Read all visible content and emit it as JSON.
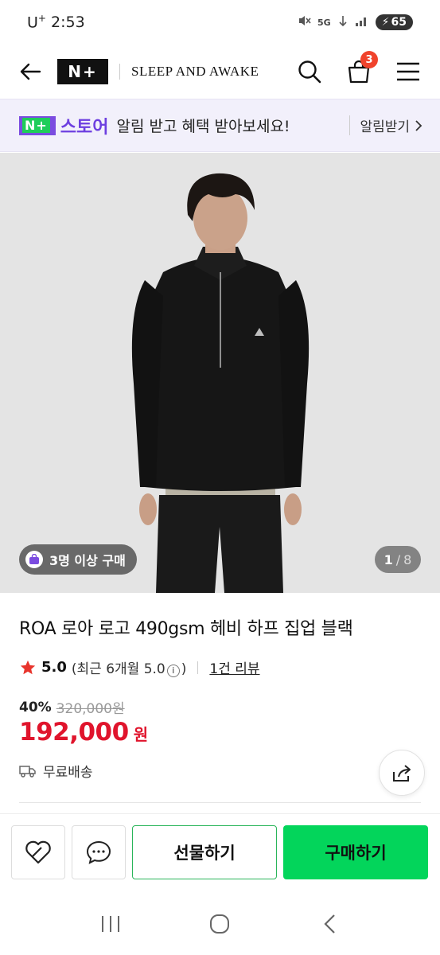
{
  "status_bar": {
    "carrier": "U",
    "carrier_sup": "+",
    "time": "2:53",
    "network": "5G",
    "battery": "65"
  },
  "header": {
    "logo_text": "N+",
    "brand_name": "SLEEP AND AWAKE",
    "cart_count": "3"
  },
  "banner": {
    "logo_mark": "N+",
    "store_label": "스토어",
    "message": "알림 받고 혜택 받아보세요!",
    "cta": "알림받기"
  },
  "gallery": {
    "purchase_chip": "3명 이상 구매",
    "current_page": "1",
    "separator": "/",
    "total_pages": "8"
  },
  "product": {
    "title": "ROA 로아 로고 490gsm 헤비 하프 집업 블랙",
    "rating": "5.0",
    "rating_detail_prefix": "(최근 6개월 5.0",
    "rating_detail_suffix": ")",
    "review_link": "1건 리뷰",
    "discount_rate": "40%",
    "original_price": "320,000원",
    "sale_price": "192,000",
    "currency": "원",
    "shipping": "무료배송"
  },
  "actions": {
    "gift_label": "선물하기",
    "buy_label": "구매하기"
  },
  "colors": {
    "sale_red": "#e0142c",
    "buy_green": "#03d55b",
    "store_purple": "#6d3fe0",
    "badge_red": "#f0432c"
  }
}
